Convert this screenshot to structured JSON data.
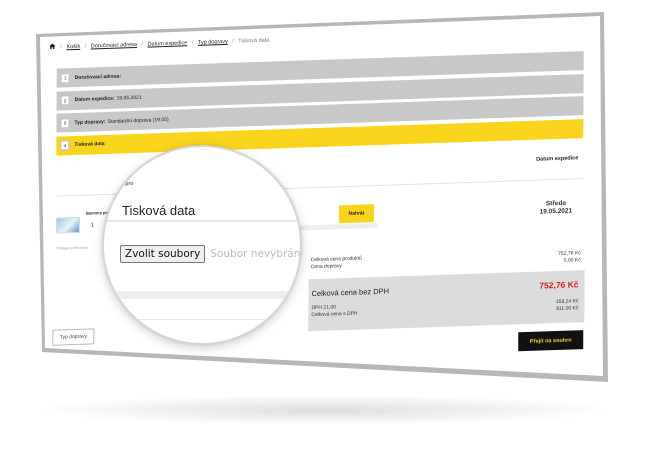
{
  "breadcrumb": {
    "home_icon": "home-icon",
    "items": [
      "Košík",
      "Doručovací adresa",
      "Datum expedice",
      "Typ dopravy"
    ],
    "current": "Tisková data"
  },
  "steps": [
    {
      "num": "1",
      "label": "Doručovací adresa:",
      "value": ""
    },
    {
      "num": "2",
      "label": "Datum expedice:",
      "value": "19.05.2021"
    },
    {
      "num": "3",
      "label": "Typ dopravy:",
      "value": "Standardní doprava (19.05)"
    },
    {
      "num": "4",
      "label": "Tisková data",
      "value": ""
    }
  ],
  "table": {
    "column_header": "Datum expedice"
  },
  "product": {
    "name": "Bannery pro",
    "qty": "1",
    "upload_label": "Nahrát",
    "ship_day": "Středa",
    "ship_date": "19.05.2021",
    "note": "*Přidejte si obrovsky"
  },
  "magnifier": {
    "section_title": "Tisková data",
    "choose_label": "Zvolit soubory",
    "no_file_text": "Soubor nevybrán"
  },
  "totals": {
    "products_label": "Celková cena produktů",
    "shipping_label": "Cena dopravy",
    "products_value": "752,76 Kč",
    "shipping_value": "0,00 Kč",
    "net_label": "Celková cena bez DPH",
    "net_value": "752,76 Kč",
    "vat_label": "DPH 21,00",
    "gross_label": "Celková cena s DPH",
    "vat_value": "158,24 Kč",
    "gross_value": "911,00 Kč"
  },
  "buttons": {
    "back_label": "Typ dopravy",
    "next_label": "Přejít na souhrn"
  },
  "colors": {
    "accent": "#f9d41c",
    "price_red": "#e02020",
    "step_gray": "#c8c8c8"
  }
}
